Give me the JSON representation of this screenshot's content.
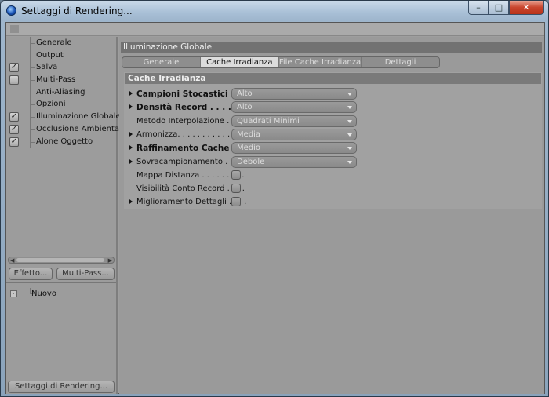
{
  "window": {
    "title": "Settaggi di Rendering...",
    "min": "–",
    "max": "□",
    "close": "✕"
  },
  "sidebar": {
    "items": [
      {
        "label": "Generale",
        "check": "none"
      },
      {
        "label": "Output",
        "check": "none"
      },
      {
        "label": "Salva",
        "check": "checked"
      },
      {
        "label": "Multi-Pass",
        "check": "unchecked"
      },
      {
        "label": "Anti-Aliasing",
        "check": "none"
      },
      {
        "label": "Opzioni",
        "check": "none"
      },
      {
        "label": "Illuminazione Globale",
        "check": "checked"
      },
      {
        "label": "Occlusione Ambientale",
        "check": "checked"
      },
      {
        "label": "Alone Oggetto",
        "check": "checked"
      }
    ],
    "effetto_button": "Effetto...",
    "multipass_button": "Multi-Pass...",
    "preset_item": "Nuovo",
    "settings_button": "Settaggi di Rendering..."
  },
  "main": {
    "section_title": "Illuminazione Globale",
    "tabs": [
      "Generale",
      "Cache Irradianza",
      "File Cache Irradianza",
      "Dettagli"
    ],
    "active_tab": "Cache Irradianza",
    "group_title": "Cache Irradianza",
    "params": [
      {
        "label": "Campioni Stocastici . . .",
        "bold": true,
        "arrow": true,
        "control": "dropdown",
        "value": "Alto"
      },
      {
        "label": "Densità Record . . . . . . .",
        "bold": true,
        "arrow": true,
        "control": "dropdown",
        "value": "Alto"
      },
      {
        "label": "Metodo Interpolazione . .",
        "bold": false,
        "arrow": false,
        "control": "dropdown",
        "value": "Quadrati Minimi"
      },
      {
        "label": "Armonizza. . . . . . . . . . . . .",
        "bold": false,
        "arrow": true,
        "control": "dropdown",
        "value": "Media"
      },
      {
        "label": "Raffinamento Cache . .",
        "bold": true,
        "arrow": true,
        "control": "dropdown",
        "value": "Medio"
      },
      {
        "label": "Sovracampionamento . . . .",
        "bold": false,
        "arrow": true,
        "control": "dropdown",
        "value": "Debole"
      },
      {
        "label": "Mappa Distanza . . . . . . . . .",
        "bold": false,
        "arrow": false,
        "control": "checkbox",
        "value": "unchecked"
      },
      {
        "label": "Visibilità Conto Record . . . .",
        "bold": false,
        "arrow": false,
        "control": "checkbox",
        "value": "unchecked"
      },
      {
        "label": "Miglioramento Dettagli . . . .",
        "bold": false,
        "arrow": true,
        "control": "checkbox",
        "value": "unchecked"
      }
    ]
  }
}
